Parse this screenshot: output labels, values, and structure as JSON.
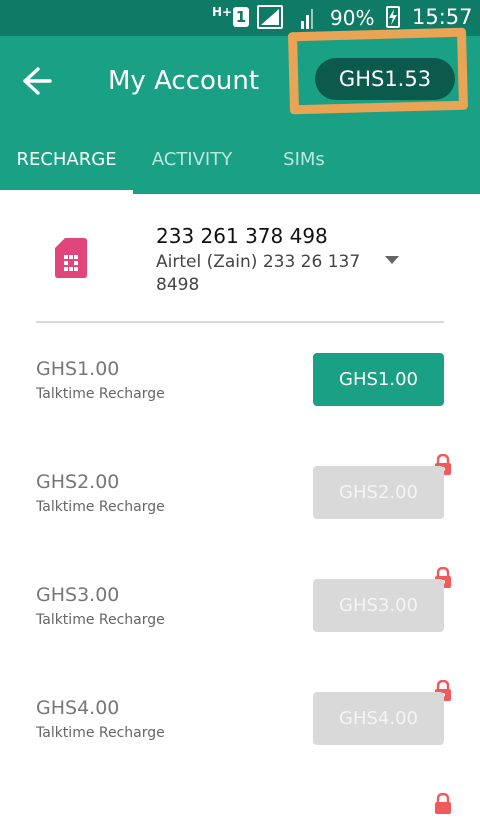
{
  "status_bar": {
    "network": "H+",
    "sim_slot": "1",
    "battery_percent": "90%",
    "time": "15:57"
  },
  "header": {
    "title": "My Account",
    "balance": "GHS1.53"
  },
  "tabs": [
    {
      "label": "RECHARGE",
      "active": true
    },
    {
      "label": "ACTIVITY",
      "active": false
    },
    {
      "label": "SIMs",
      "active": false
    }
  ],
  "sim": {
    "number": "233 261 378 498",
    "operator": "Airtel (Zain) 233 26 137 8498"
  },
  "recharges": [
    {
      "amount": "GHS1.00",
      "type": "Talktime Recharge",
      "button": "GHS1.00",
      "locked": false
    },
    {
      "amount": "GHS2.00",
      "type": "Talktime Recharge",
      "button": "GHS2.00",
      "locked": true
    },
    {
      "amount": "GHS3.00",
      "type": "Talktime Recharge",
      "button": "GHS3.00",
      "locked": true
    },
    {
      "amount": "GHS4.00",
      "type": "Talktime Recharge",
      "button": "GHS4.00",
      "locked": true
    }
  ],
  "colors": {
    "status_bar": "#0f7a66",
    "primary": "#1aa084",
    "balance_pill": "#0c5a4b",
    "sim_icon": "#e0457b",
    "lock": "#ef5a5a",
    "annotation": "#e9a455"
  }
}
